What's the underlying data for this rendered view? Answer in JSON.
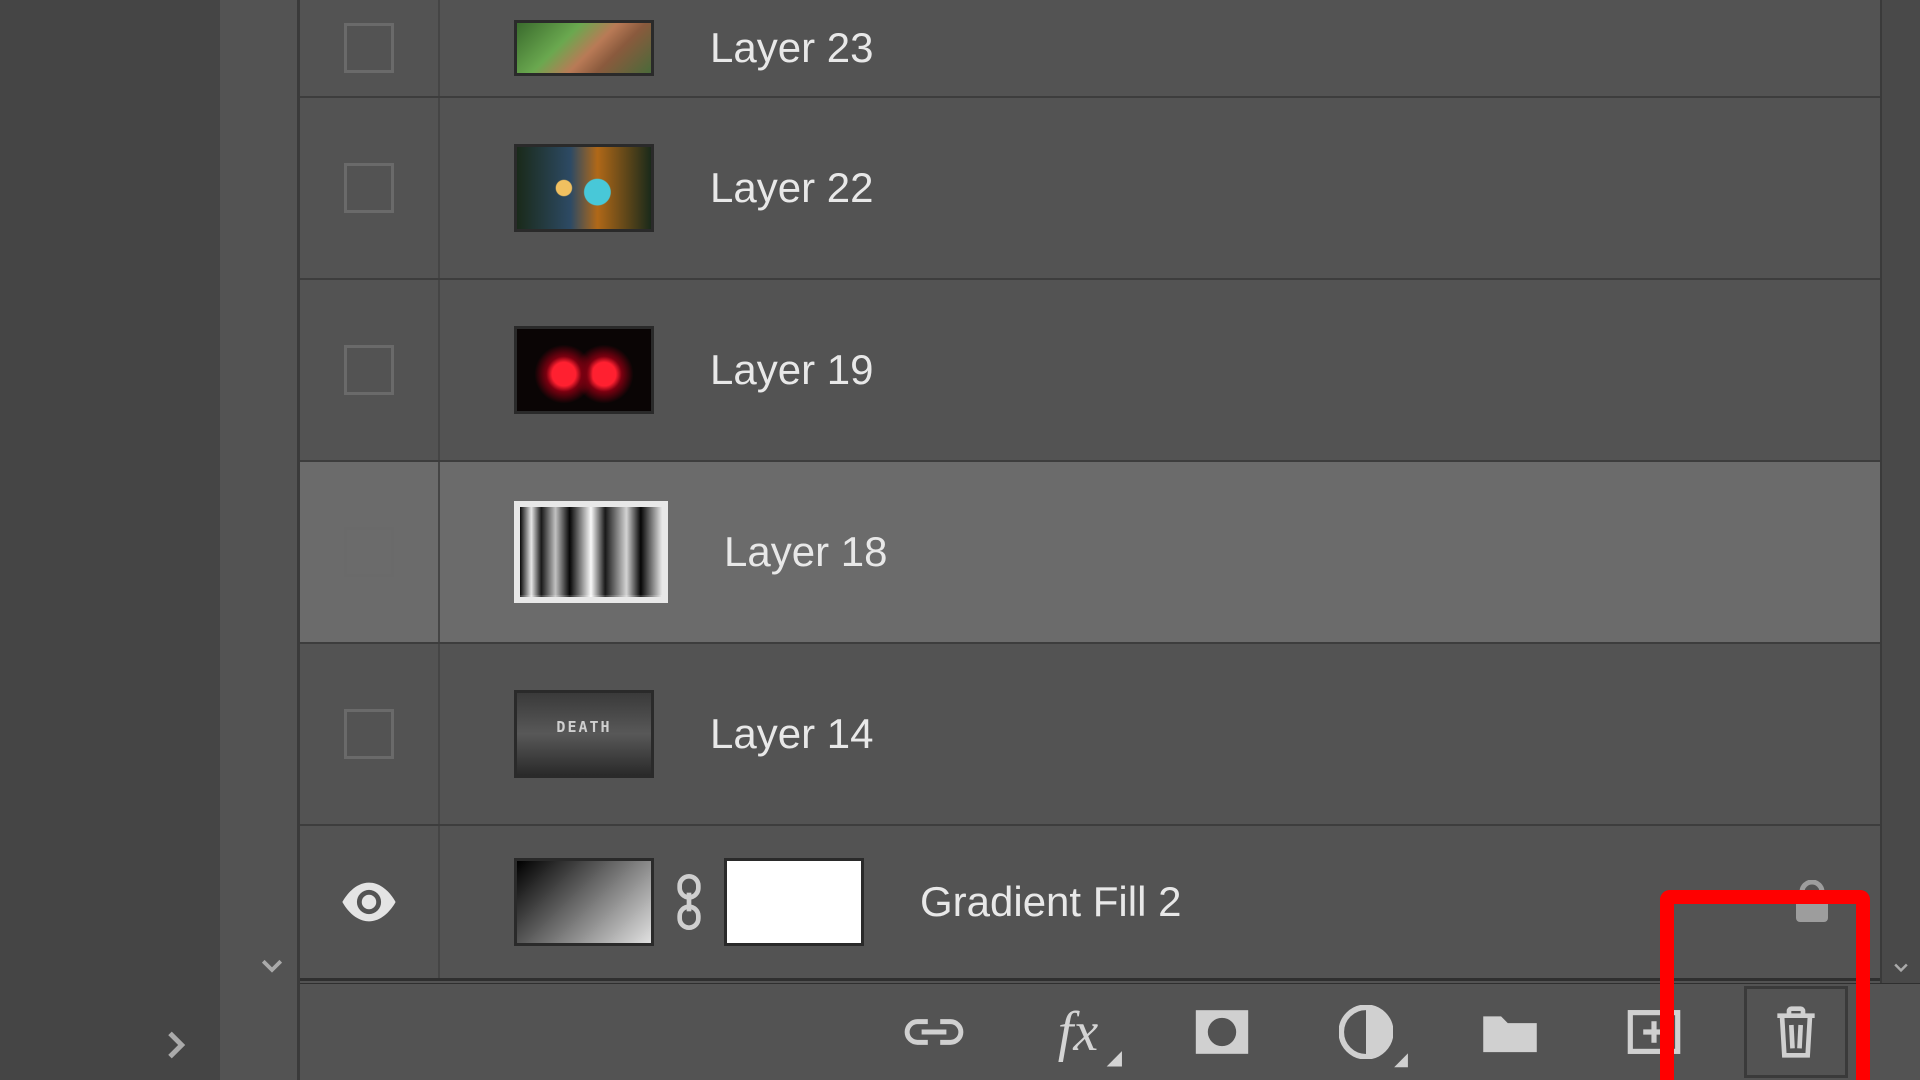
{
  "layers": [
    {
      "name": "Layer 23",
      "visible": false,
      "selected": false,
      "type": "bitmap"
    },
    {
      "name": "Layer 22",
      "visible": false,
      "selected": false,
      "type": "bitmap"
    },
    {
      "name": "Layer 19",
      "visible": false,
      "selected": false,
      "type": "bitmap"
    },
    {
      "name": "Layer 18",
      "visible": false,
      "selected": true,
      "type": "bitmap"
    },
    {
      "name": "Layer 14",
      "visible": false,
      "selected": false,
      "type": "bitmap"
    },
    {
      "name": "Gradient Fill 2",
      "visible": true,
      "selected": false,
      "type": "adjustment",
      "locked": true
    }
  ],
  "toolbar": {
    "link": "link-layers",
    "fx": "fx",
    "mask": "add-layer-mask",
    "adjustment": "new-adjustment-layer",
    "group": "new-group",
    "new": "new-layer",
    "delete": "delete-layer"
  }
}
